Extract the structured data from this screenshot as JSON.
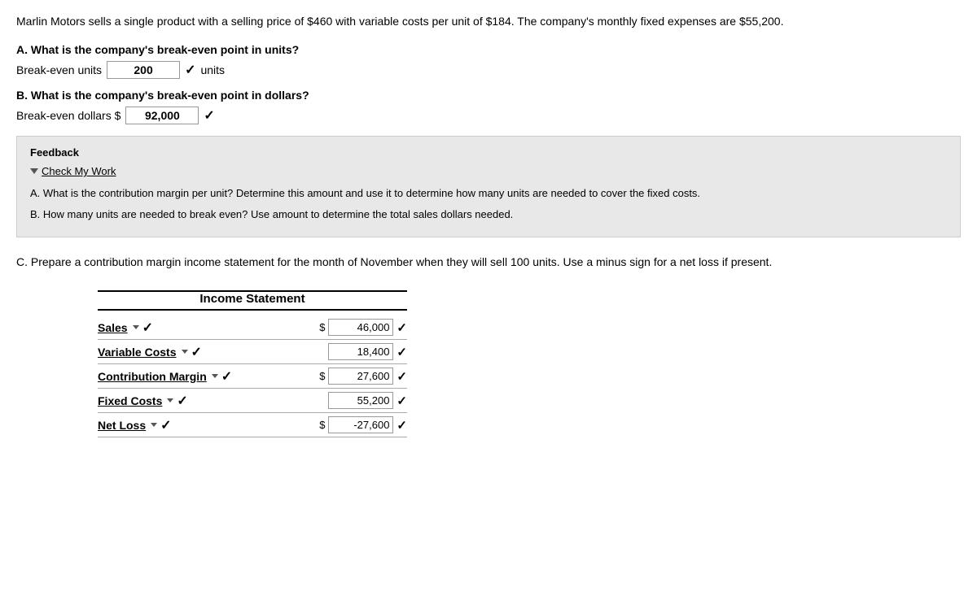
{
  "intro": {
    "text": "Marlin Motors sells a single product with a selling price of $460 with variable costs per unit of $184. The company's monthly fixed expenses are $55,200."
  },
  "question_a": {
    "label": "A. What is the company's break-even point in units?",
    "field_label": "Break-even units",
    "value": "200",
    "suffix": "units"
  },
  "question_b": {
    "label": "B. What is the company's break-even point in dollars?",
    "field_label": "Break-even dollars $",
    "value": "92,000"
  },
  "feedback": {
    "title": "Feedback",
    "cmw_label": "Check My Work",
    "hint_a": "A. What is the contribution margin per unit? Determine this amount and use it to determine how many units are needed to cover the fixed costs.",
    "hint_b": "B. How many units are needed to break even? Use amount to determine the total sales dollars needed."
  },
  "question_c": {
    "label": "C. Prepare a contribution margin income statement for the month of November when they will sell 100 units. Use a minus sign for a net loss if present."
  },
  "income_statement": {
    "title": "Income Statement",
    "rows": [
      {
        "label": "Sales",
        "dollar_prefix": "$",
        "value": "46,000",
        "has_dollar": true
      },
      {
        "label": "Variable Costs",
        "dollar_prefix": "",
        "value": "18,400",
        "has_dollar": false
      },
      {
        "label": "Contribution Margin",
        "dollar_prefix": "$",
        "value": "27,600",
        "has_dollar": true
      },
      {
        "label": "Fixed Costs",
        "dollar_prefix": "",
        "value": "55,200",
        "has_dollar": false
      },
      {
        "label": "Net Loss",
        "dollar_prefix": "$",
        "value": "-27,600",
        "has_dollar": true
      }
    ]
  }
}
